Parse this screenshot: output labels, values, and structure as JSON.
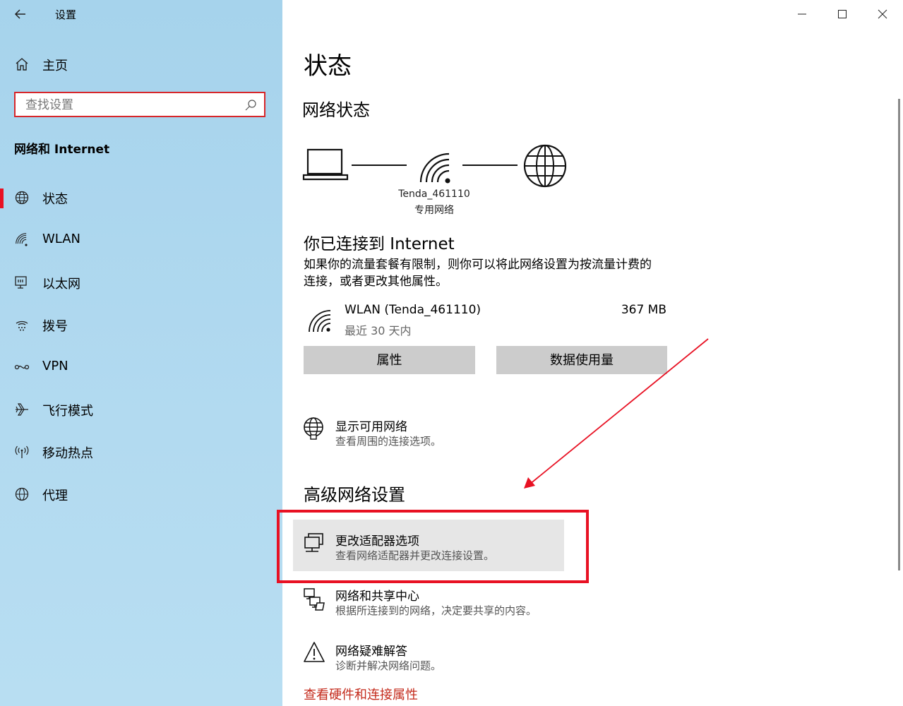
{
  "window": {
    "title": "设置",
    "minimize_icon": "minimize-icon",
    "maximize_icon": "maximize-icon",
    "close_icon": "close-icon"
  },
  "sidebar": {
    "home_label": "主页",
    "search_placeholder": "查找设置",
    "category": "网络和 Internet",
    "items": [
      {
        "label": "状态",
        "icon": "status-globe-icon",
        "active": true
      },
      {
        "label": "WLAN",
        "icon": "wifi-icon"
      },
      {
        "label": "以太网",
        "icon": "ethernet-icon"
      },
      {
        "label": "拨号",
        "icon": "dialup-icon"
      },
      {
        "label": "VPN",
        "icon": "vpn-icon"
      },
      {
        "label": "飞行模式",
        "icon": "airplane-icon"
      },
      {
        "label": "移动热点",
        "icon": "hotspot-icon"
      },
      {
        "label": "代理",
        "icon": "proxy-globe-icon"
      }
    ]
  },
  "main": {
    "title": "状态",
    "network_status_heading": "网络状态",
    "diagram": {
      "network_name": "Tenda_461110",
      "network_type": "专用网络"
    },
    "connected_heading": "你已连接到 Internet",
    "connected_desc_line1": "如果你的流量套餐有限制，则你可以将此网络设置为按流量计费的",
    "connected_desc_line2": "连接，或者更改其他属性。",
    "connection": {
      "name": "WLAN (Tenda_461110)",
      "period": "最近 30 天内",
      "usage": "367 MB"
    },
    "buttons": {
      "properties": "属性",
      "data_usage": "数据使用量"
    },
    "show_networks": {
      "title": "显示可用网络",
      "desc": "查看周围的连接选项。"
    },
    "advanced_heading": "高级网络设置",
    "advanced_items": [
      {
        "title": "更改适配器选项",
        "desc": "查看网络适配器并更改连接设置。"
      },
      {
        "title": "网络和共享中心",
        "desc": "根据所连接到的网络，决定要共享的内容。"
      },
      {
        "title": "网络疑难解答",
        "desc": "诊断并解决网络问题。"
      }
    ],
    "hardware_link": "查看硬件和连接属性"
  },
  "colors": {
    "accent_red": "#e81123",
    "link_red": "#c42b1c",
    "button_gray": "#cccccc",
    "hover_gray": "#e6e6e6"
  }
}
